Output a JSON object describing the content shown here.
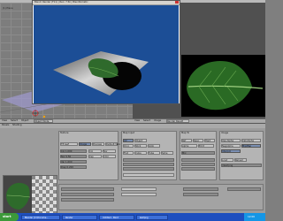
{
  "render_window": {
    "title": "Blend: Render (F11) | Ren: 7.5k | Blendtomatic",
    "close_glyph": "×",
    "canvas_color": "#1c4e96",
    "plane_color": "#c9c9c9",
    "leaf_color": "#2f6a2c"
  },
  "viewport": {
    "label": "(1) Plane",
    "header_items": [
      "View",
      "Select",
      "Object",
      "Object Mode"
    ]
  },
  "image_viewer": {
    "header_items": [
      "View",
      "Select",
      "Image",
      "Render Result"
    ],
    "leaf_color": "#2a6a24"
  },
  "buttons": {
    "header_items": [
      "Panels",
      "Shading"
    ],
    "map_input": {
      "title": "Map Input",
      "buttons": [
        "UV",
        "Object",
        "Orco",
        "Stick",
        "Glob",
        "Nor",
        "Refl",
        "Flat",
        "Cube",
        "Tube",
        "Sphe"
      ]
    },
    "map_to": {
      "title": "Map To",
      "buttons": [
        "Col",
        "Nor",
        "Csp",
        "Cmir",
        "Ref",
        "Spec",
        "Hard",
        "Alpha",
        "Emit"
      ],
      "values": [
        "Mix",
        "Col 1.000",
        "Nor 0.50",
        "Var 1.000",
        "Disp 0.200"
      ]
    },
    "texture": {
      "title": "Texture",
      "buttons": [
        "Tex",
        "Image",
        "Preview",
        "Default Vars"
      ],
      "name": "TE:leaf",
      "type": "Image"
    },
    "image": {
      "title": "Image",
      "buttons": [
        "Load",
        "Reload",
        "Use Alpha",
        "CalcAlpha",
        "NegAlpha",
        "MipMap",
        "Interpol"
      ],
      "path": "//leaf.png"
    }
  },
  "taskbar": {
    "start_label": "start",
    "tasks": [
      {
        "label": "Blender [C:\\Docume..."
      },
      {
        "label": "Render"
      },
      {
        "label": "Untitled - Paint"
      },
      {
        "label": "leaf.png"
      }
    ],
    "clock": "12:00"
  }
}
